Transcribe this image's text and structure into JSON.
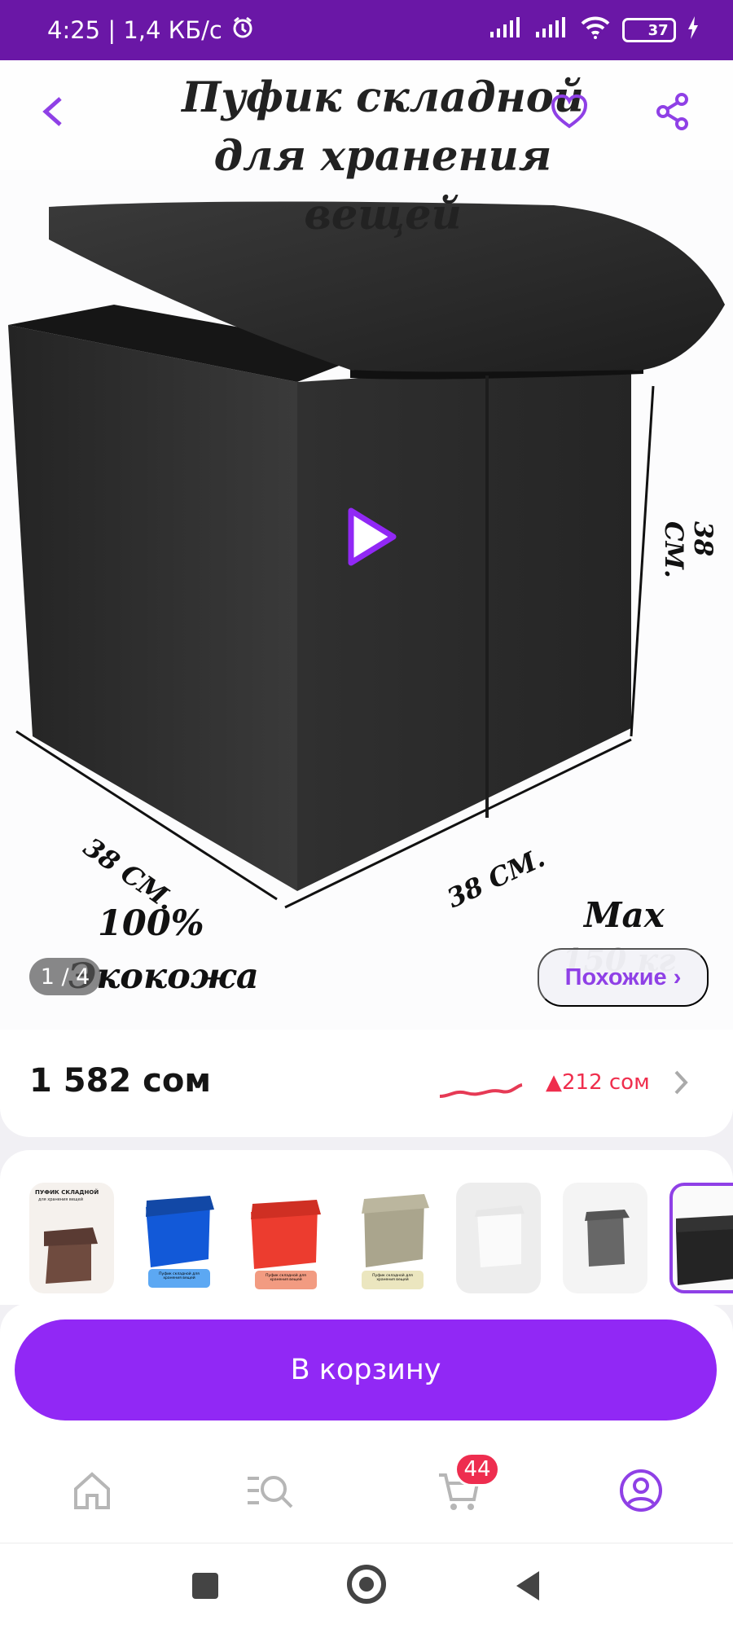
{
  "status_bar": {
    "time_speed": "4:25 | 1,4 КБ/с",
    "battery": "37"
  },
  "product": {
    "title_line1": "Пуфик складной",
    "title_line2": "для хранения вещей",
    "dimension_height": "38 СМ.",
    "dimension_depth": "38 СМ.",
    "dimension_width": "38 СМ.",
    "material_line1": "100%",
    "material_line2": "Экокожа",
    "max_label": "Max",
    "max_value": "150 кг",
    "image_counter": "1 / 4",
    "similar_label": "Похожие ›"
  },
  "pricing": {
    "price": "1 582 сом",
    "price_change": "▲212 сом"
  },
  "variants": {
    "mini_title": "ПУФИК СКЛАДНОЙ",
    "mini_subtitle": "для хранения вещей",
    "mini_badge": "Пуфик складной для хранения вещей"
  },
  "actions": {
    "add_to_cart": "В корзину"
  },
  "bottom_nav": {
    "cart_badge": "44"
  },
  "colors": {
    "brand_purple": "#9128f5",
    "status_purple": "#6a17a6",
    "price_red": "#ef2e4d"
  }
}
